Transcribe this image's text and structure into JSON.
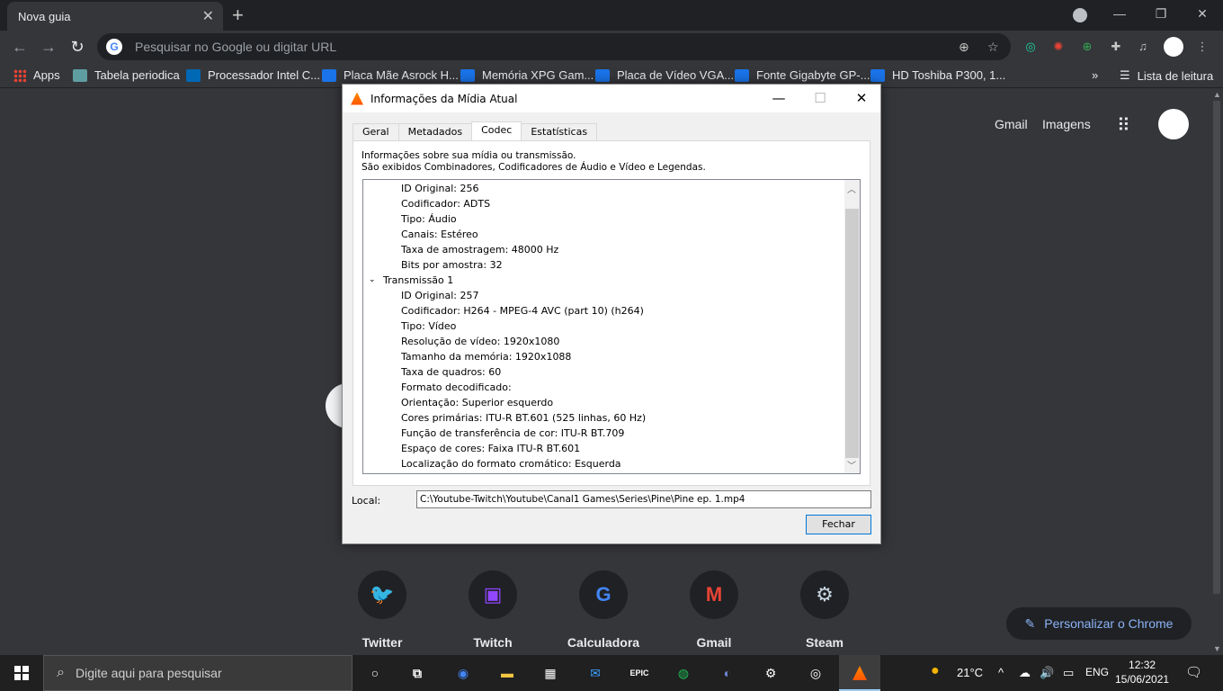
{
  "browser": {
    "tab_title": "Nova guia",
    "tab_close": "✕",
    "new_tab": "+",
    "omnibox_placeholder": "Pesquisar no Google ou digitar URL",
    "bookmarks": [
      {
        "label": "Apps",
        "color": "#ea4335"
      },
      {
        "label": "Tabela periodica",
        "color": "#5f9ea0"
      },
      {
        "label": "Processador Intel C...",
        "color": "#0068b5"
      },
      {
        "label": "Placa Mãe Asrock H...",
        "color": "#1a73e8"
      },
      {
        "label": "Memória XPG Gam...",
        "color": "#1a73e8"
      },
      {
        "label": "Placa de Vídeo VGA...",
        "color": "#1a73e8"
      },
      {
        "label": "Fonte Gigabyte GP-...",
        "color": "#1a73e8"
      },
      {
        "label": "HD Toshiba P300, 1...",
        "color": "#1a73e8"
      }
    ],
    "bookmarks_overflow": "»",
    "reading_list": "Lista de leitura"
  },
  "ntp": {
    "gmail": "Gmail",
    "images": "Imagens",
    "shortcuts": [
      {
        "label": "Twitter",
        "glyph": "t",
        "color": "#1da1f2"
      },
      {
        "label": "Twitch",
        "glyph": "▣",
        "color": "#9146ff"
      },
      {
        "label": "Calculadora",
        "glyph": "G",
        "color": "#4285f4"
      },
      {
        "label": "Gmail",
        "glyph": "M",
        "color": "#ea4335"
      },
      {
        "label": "Steam",
        "glyph": "⚙",
        "color": "#1b2838"
      }
    ],
    "customize": "Personalizar o Chrome"
  },
  "dialog": {
    "title": "Informações da Mídia Atual",
    "tabs": [
      "Geral",
      "Metadados",
      "Codec",
      "Estatísticas"
    ],
    "active_tab": "Codec",
    "info_line1": "Informações sobre sua mídia ou transmissão.",
    "info_line2": "São exibidos Combinadores, Codificadores de Áudio e Vídeo e Legendas.",
    "tree_rows": [
      {
        "text": "ID Original: 256",
        "level": 1
      },
      {
        "text": "Codificador: ADTS",
        "level": 1
      },
      {
        "text": "Tipo: Áudio",
        "level": 1
      },
      {
        "text": "Canais: Estéreo",
        "level": 1
      },
      {
        "text": "Taxa de amostragem: 48000 Hz",
        "level": 1
      },
      {
        "text": "Bits por amostra: 32",
        "level": 1
      },
      {
        "text": "Transmissão 1",
        "level": 0
      },
      {
        "text": "ID Original: 257",
        "level": 1
      },
      {
        "text": "Codificador: H264 - MPEG-4 AVC (part 10) (h264)",
        "level": 1
      },
      {
        "text": "Tipo: Vídeo",
        "level": 1
      },
      {
        "text": "Resolução de vídeo: 1920x1080",
        "level": 1
      },
      {
        "text": "Tamanho da memória: 1920x1088",
        "level": 1
      },
      {
        "text": "Taxa de quadros: 60",
        "level": 1
      },
      {
        "text": "Formato decodificado:",
        "level": 1
      },
      {
        "text": "Orientação: Superior esquerdo",
        "level": 1
      },
      {
        "text": "Cores primárias: ITU-R BT.601 (525 linhas, 60 Hz)",
        "level": 1
      },
      {
        "text": "Função de transferência de cor: ITU-R BT.709",
        "level": 1
      },
      {
        "text": "Espaço de cores: Faixa ITU-R BT.601",
        "level": 1
      },
      {
        "text": "Localização do formato cromático: Esquerda",
        "level": 1
      }
    ],
    "local_label": "Local:",
    "local_value": "C:\\Youtube-Twitch\\Youtube\\Canal1 Games\\Series\\Pine\\Pine ep. 1.mp4",
    "close_label": "Fechar"
  },
  "taskbar": {
    "search_placeholder": "Digite aqui para pesquisar",
    "temperature": "21°C",
    "language": "ENG",
    "time": "12:32",
    "date": "15/06/2021"
  }
}
